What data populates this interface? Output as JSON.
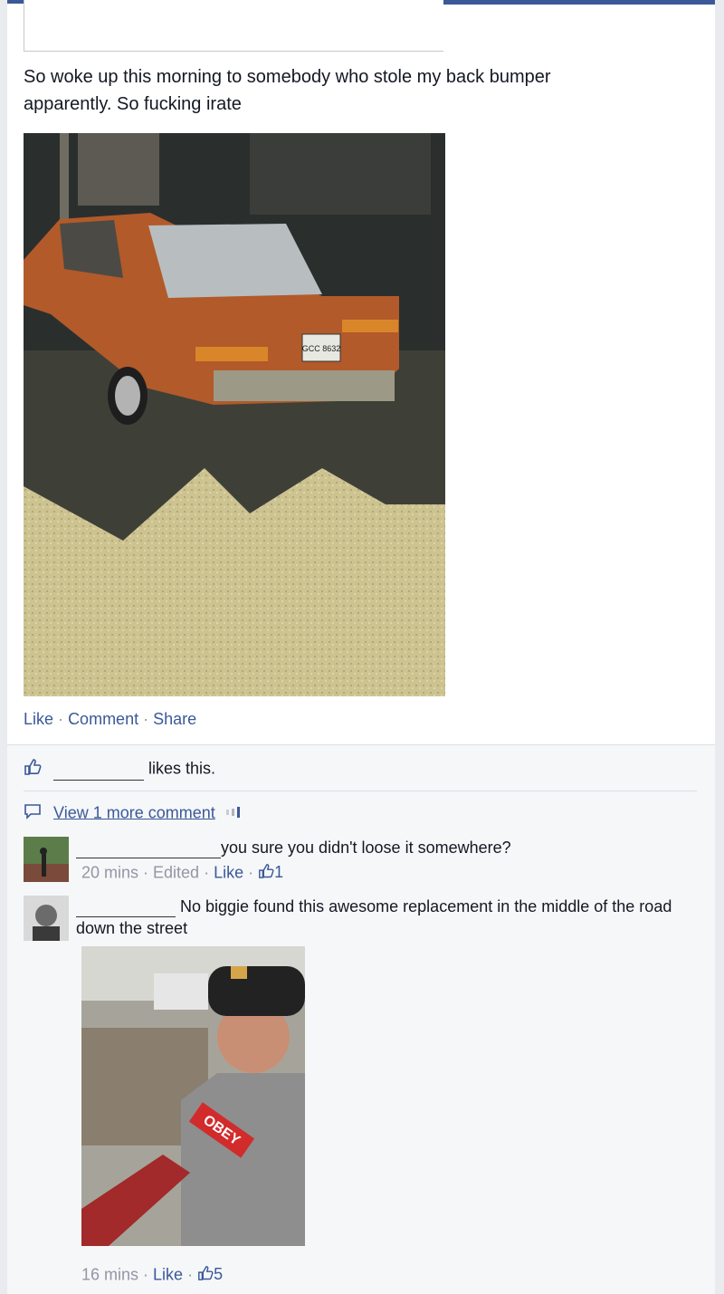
{
  "post": {
    "text": "So woke up this morning to somebody who stole my back bumper apparently. So fucking irate",
    "plate": "GCC 8632",
    "actions": {
      "like": "Like",
      "comment": "Comment",
      "share": "Share",
      "separator": "·"
    }
  },
  "likes": {
    "text": "likes this."
  },
  "view_more": {
    "label": "View 1 more comment"
  },
  "comments": [
    {
      "text": "you sure you didn't loose it somewhere?",
      "time": "20 mins",
      "edited": "Edited",
      "like": "Like",
      "like_count": "1"
    },
    {
      "text": "No biggie found this awesome replacement in the middle of the road down the street",
      "photo_text": "OBEY",
      "time": "16 mins",
      "like": "Like",
      "like_count": "5"
    }
  ],
  "colors": {
    "link": "#3b5998",
    "meta": "#9197a3",
    "text": "#141823",
    "feedback_bg": "#f6f7f9"
  },
  "icons": [
    "thumbs-up-icon",
    "comment-bubble-icon",
    "loading-icon"
  ]
}
